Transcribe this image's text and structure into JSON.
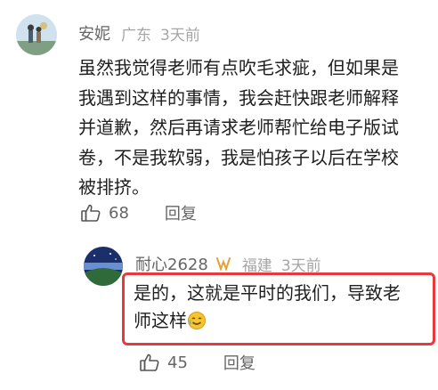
{
  "comment1": {
    "author": "安妮",
    "location": "广东",
    "time": "3天前",
    "lines": [
      "虽然我觉得老师有点吹毛求疵，但如果是",
      "我遇到这样的事情，我会赶快跟老师解释",
      "并道歉，然后再请求老师帮忙给电子版试",
      "卷，不是我软弱，我是怕孩子以后在学校",
      "被排挤。"
    ],
    "likes": "68",
    "reply_label": "回复"
  },
  "comment2": {
    "author": "耐心2628",
    "location": "福建",
    "time": "3天前",
    "line1": "是的，这就是平时的我们，导致老",
    "line2": "师这样",
    "likes": "45",
    "reply_label": "回复"
  },
  "colors": {
    "highlight_border": "#e83a3e",
    "meta_gray": "#a6a6a6",
    "name_gray": "#666666"
  },
  "icons": [
    "avatar-image",
    "thumbs-up-icon",
    "badge-icon",
    "emoji-icon"
  ]
}
